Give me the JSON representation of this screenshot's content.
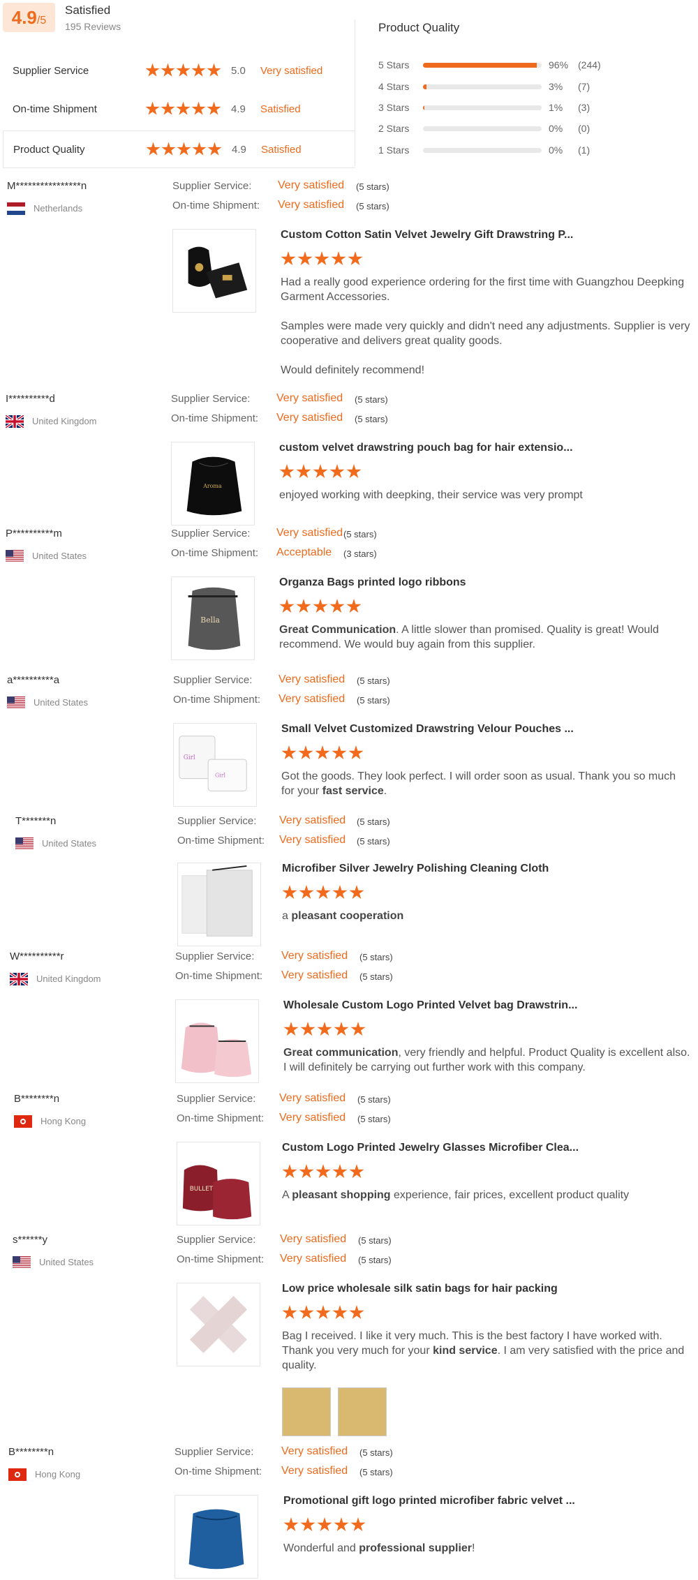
{
  "summary": {
    "score": "4.9",
    "out_of": "/5",
    "label": "Satisfied",
    "reviews": "195 Reviews"
  },
  "metrics": [
    {
      "label": "Supplier Service",
      "score": "5.0",
      "text": "Very satisfied"
    },
    {
      "label": "On-time Shipment",
      "score": "4.9",
      "text": "Satisfied"
    },
    {
      "label": "Product Quality",
      "score": "4.9",
      "text": "Satisfied"
    }
  ],
  "product_quality": {
    "title": "Product Quality",
    "rows": [
      {
        "label": "5 Stars",
        "pct": "96%",
        "count": "(244)",
        "fraction": 0.96
      },
      {
        "label": "4 Stars",
        "pct": "3%",
        "count": "(7)",
        "fraction": 0.03
      },
      {
        "label": "3 Stars",
        "pct": "1%",
        "count": "(3)",
        "fraction": 0.01
      },
      {
        "label": "2 Stars",
        "pct": "0%",
        "count": "(0)",
        "fraction": 0
      },
      {
        "label": "1 Stars",
        "pct": "0%",
        "count": "(1)",
        "fraction": 0
      }
    ]
  },
  "labels": {
    "supplier_service": "Supplier Service:",
    "on_time_shipment": "On-time Shipment:"
  },
  "reviews": [
    {
      "name": "M****************n",
      "country": "Netherlands",
      "flag": "nl",
      "service": "Very satisfied",
      "service_stars": "(5 stars)",
      "shipment": "Very satisfied",
      "shipment_stars": "(5 stars)",
      "title": "Custom Cotton Satin Velvet Jewelry Gift Drawstring P...",
      "rating": 5,
      "text_parts": [
        "Had a really good experience ordering for the first time with Guangzhou Deepking Garment Accessories.",
        "Samples were made very quickly and didn't need any adjustments. Supplier is very cooperative and delivers great quality goods.",
        "Would definitely recommend!"
      ]
    },
    {
      "name": "I**********d",
      "country": "United Kingdom",
      "flag": "uk",
      "service": "Very satisfied",
      "service_stars": "(5 stars)",
      "shipment": "Very satisfied",
      "shipment_stars": "(5 stars)",
      "title": "custom velvet drawstring pouch bag for hair extensio...",
      "rating": 5,
      "text": "enjoyed working with deepking, their service was very prompt"
    },
    {
      "name": "P**********m",
      "country": "United States",
      "flag": "us",
      "service": "Very satisfied",
      "service_stars": "(5 stars)",
      "shipment": "Acceptable",
      "shipment_stars": "(3 stars)",
      "title": "Organza Bags printed logo ribbons",
      "rating": 5,
      "bold": "Great Communication",
      "text": ". A little slower than promised. Quality is great! Would recommend. We would buy again from this supplier."
    },
    {
      "name": "a**********a",
      "country": "United States",
      "flag": "us",
      "service": "Very satisfied",
      "service_stars": "(5 stars)",
      "shipment": "Very satisfied",
      "shipment_stars": "(5 stars)",
      "title": "Small Velvet Customized Drawstring Velour Pouches ...",
      "rating": 5,
      "text": "Got the goods. They look perfect. I will order soon as usual. Thank you so much for your ",
      "bold_after": "fast service",
      "text_after": "."
    },
    {
      "name": "T*******n",
      "country": "United States",
      "flag": "us",
      "service": "Very satisfied",
      "service_stars": "(5 stars)",
      "shipment": "Very satisfied",
      "shipment_stars": "(5 stars)",
      "title": "Microfiber Silver Jewelry Polishing Cleaning Cloth",
      "rating": 5,
      "text": "a ",
      "bold_after": "pleasant cooperation",
      "text_after": ""
    },
    {
      "name": "W**********r",
      "country": "United Kingdom",
      "flag": "uk",
      "service": "Very satisfied",
      "service_stars": "(5 stars)",
      "shipment": "Very satisfied",
      "shipment_stars": "(5 stars)",
      "title": "Wholesale Custom Logo Printed Velvet bag Drawstrin...",
      "rating": 5,
      "bold": "Great communication",
      "text": ", very friendly and helpful.  Product Quality is excellent also. I will definitely be carrying out further work with this company."
    },
    {
      "name": "B********n",
      "country": "Hong Kong",
      "flag": "hk",
      "service": "Very satisfied",
      "service_stars": "(5 stars)",
      "shipment": "Very satisfied",
      "shipment_stars": "(5 stars)",
      "title": "Custom Logo Printed Jewelry Glasses Microfiber Clea...",
      "rating": 5,
      "text": "A ",
      "bold_after": "pleasant shopping",
      "text_after": " experience, fair prices, excellent product quality"
    },
    {
      "name": "s******y",
      "country": "United States",
      "flag": "us",
      "service": "Very satisfied",
      "service_stars": "(5 stars)",
      "shipment": "Very satisfied",
      "shipment_stars": "(5 stars)",
      "title": "Low price wholesale silk satin bags for hair packing",
      "rating": 5,
      "text": "Bag I received. I like it very much. This is the best factory I have worked with. Thank you very much for your ",
      "bold_after": "kind service",
      "text_after": ". I am very satisfied with the price and quality."
    },
    {
      "name": "B********n",
      "country": "Hong Kong",
      "flag": "hk",
      "service": "Very satisfied",
      "service_stars": "(5 stars)",
      "shipment": "Very satisfied",
      "shipment_stars": "(5 stars)",
      "title": "Promotional gift logo printed microfiber fabric velvet ...",
      "rating": 5,
      "text": "Wonderful and ",
      "bold_after": "professional supplier",
      "text_after": "!"
    }
  ],
  "colors": {
    "accent": "#ee6a1c",
    "score_bg": "#fde6d6"
  }
}
